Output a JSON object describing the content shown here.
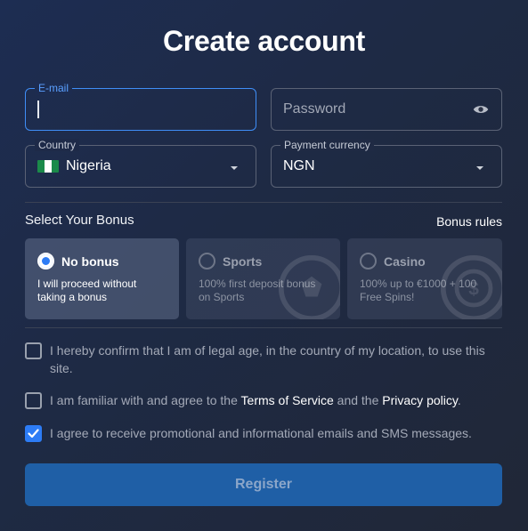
{
  "title": "Create account",
  "email": {
    "label": "E-mail",
    "value": ""
  },
  "password": {
    "placeholder": "Password",
    "icon": "eye-icon"
  },
  "country": {
    "label": "Country",
    "value": "Nigeria",
    "flag_colors": [
      "#1b8a4a",
      "#ffffff",
      "#1b8a4a"
    ]
  },
  "currency": {
    "label": "Payment currency",
    "value": "NGN"
  },
  "bonus": {
    "section_title": "Select Your Bonus",
    "rules_link": "Bonus rules",
    "options": [
      {
        "name": "No bonus",
        "desc_line1": "I will proceed without",
        "desc_line2": "taking a bonus",
        "selected": true
      },
      {
        "name": "Sports",
        "desc_line1": "100% first deposit bonus",
        "desc_line2": "on Sports",
        "selected": false
      },
      {
        "name": "Casino",
        "desc_line1": "100% up to €1000 + 100",
        "desc_line2": "Free Spins!",
        "selected": false
      }
    ]
  },
  "consents": {
    "age": {
      "text": "I hereby confirm that I am of legal age, in the country of my location, to use this site.",
      "checked": false
    },
    "terms": {
      "prefix": "I am familiar with and agree to the ",
      "terms_link": "Terms of Service",
      "middle": " and the ",
      "privacy_link": "Privacy policy",
      "suffix": ".",
      "checked": false
    },
    "marketing": {
      "text": "I agree to receive promotional and informational emails and SMS messages.",
      "checked": true
    }
  },
  "register_label": "Register",
  "colors": {
    "accent": "#2d7cf5",
    "register_bg": "#1f5fa6",
    "focus_border": "#3f8ef7"
  }
}
